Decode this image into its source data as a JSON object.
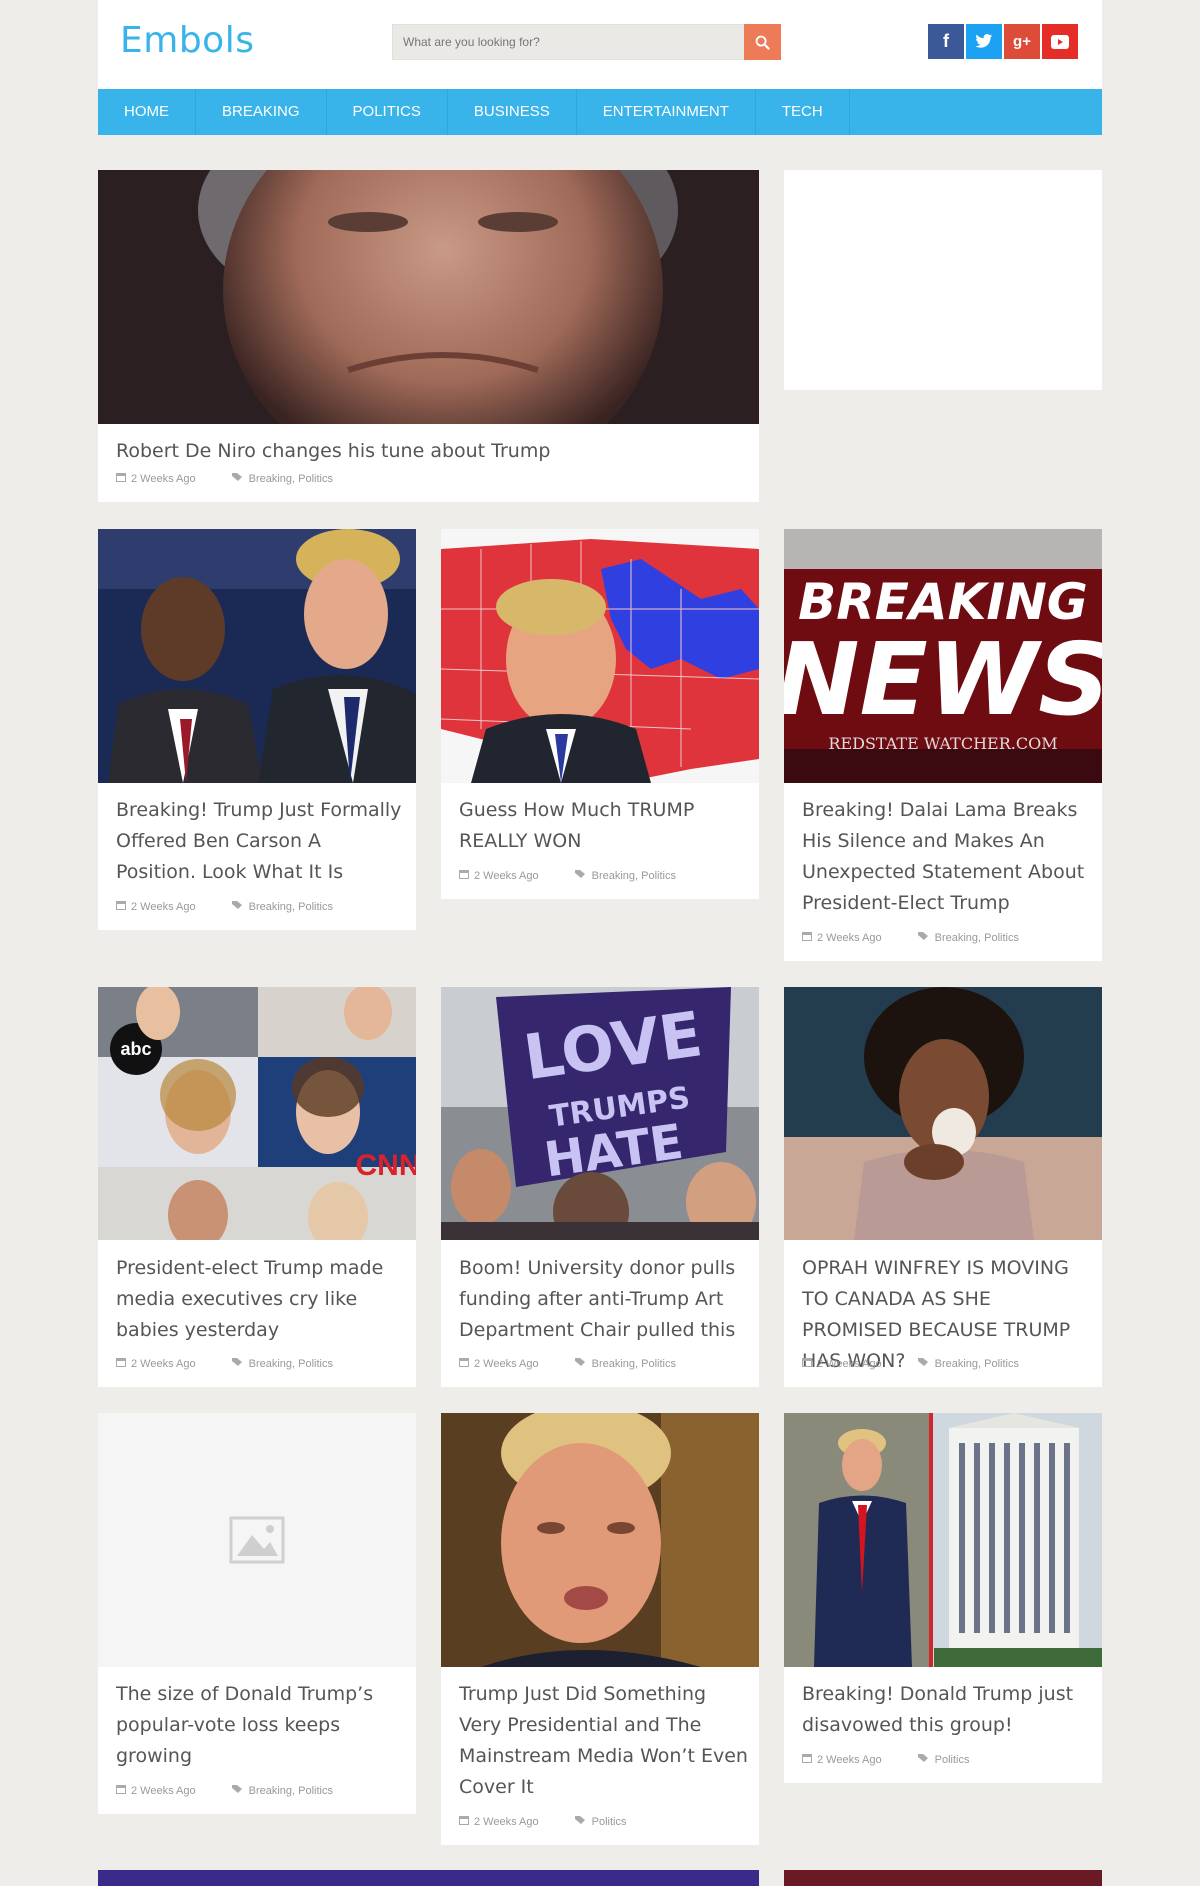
{
  "site": {
    "logo": "Embols"
  },
  "search": {
    "placeholder": "What are you looking for?"
  },
  "social": [
    "facebook-icon",
    "twitter-icon",
    "google-plus-icon",
    "youtube-icon"
  ],
  "nav": [
    "HOME",
    "BREAKING",
    "POLITICS",
    "BUSINESS",
    "ENTERTAINMENT",
    "TECH"
  ],
  "colors": {
    "accent": "#39b4ea",
    "search_button": "#ee7b57",
    "page_bg": "#efedea"
  },
  "featured": {
    "title": "Robert De Niro changes his tune about Trump",
    "time": "2 Weeks Ago",
    "tags": "Breaking, Politics"
  },
  "grid": [
    {
      "title": "Breaking! Trump Just Formally Offered Ben Carson A Position. Look What It Is",
      "time": "2 Weeks Ago",
      "tags": "Breaking, Politics"
    },
    {
      "title": "Guess How Much TRUMP REALLY WON",
      "time": "2 Weeks Ago",
      "tags": "Breaking, Politics"
    },
    {
      "title": "Breaking! Dalai Lama Breaks His Silence and Makes An Unexpected Statement About President-Elect Trump",
      "time": "2 Weeks Ago",
      "tags": "Breaking, Politics",
      "image_text": [
        "BREAKING",
        "NEWS",
        "REDSTATE WATCHER.COM"
      ]
    },
    {
      "title": "President-elect Trump made media executives cry like babies yesterday",
      "time": "2 Weeks Ago",
      "tags": "Breaking, Politics"
    },
    {
      "title": "Boom! University donor pulls funding after anti-Trump Art Department Chair pulled this",
      "time": "2 Weeks Ago",
      "tags": "Breaking, Politics"
    },
    {
      "title": "OPRAH WINFREY IS MOVING TO CANADA AS SHE PROMISED BECAUSE TRUMP HAS WON?",
      "time": "2 Weeks Ago",
      "tags": "Breaking, Politics"
    },
    {
      "title": "The size of Donald Trump’s popular-vote loss keeps growing",
      "time": "2 Weeks Ago",
      "tags": "Breaking, Politics"
    },
    {
      "title": "Trump Just Did Something Very Presidential and The Mainstream Media Won’t Even Cover It",
      "time": "2 Weeks Ago",
      "tags": "Politics"
    },
    {
      "title": "Breaking! Donald Trump just disavowed this group!",
      "time": "2 Weeks Ago",
      "tags": "Politics"
    }
  ]
}
